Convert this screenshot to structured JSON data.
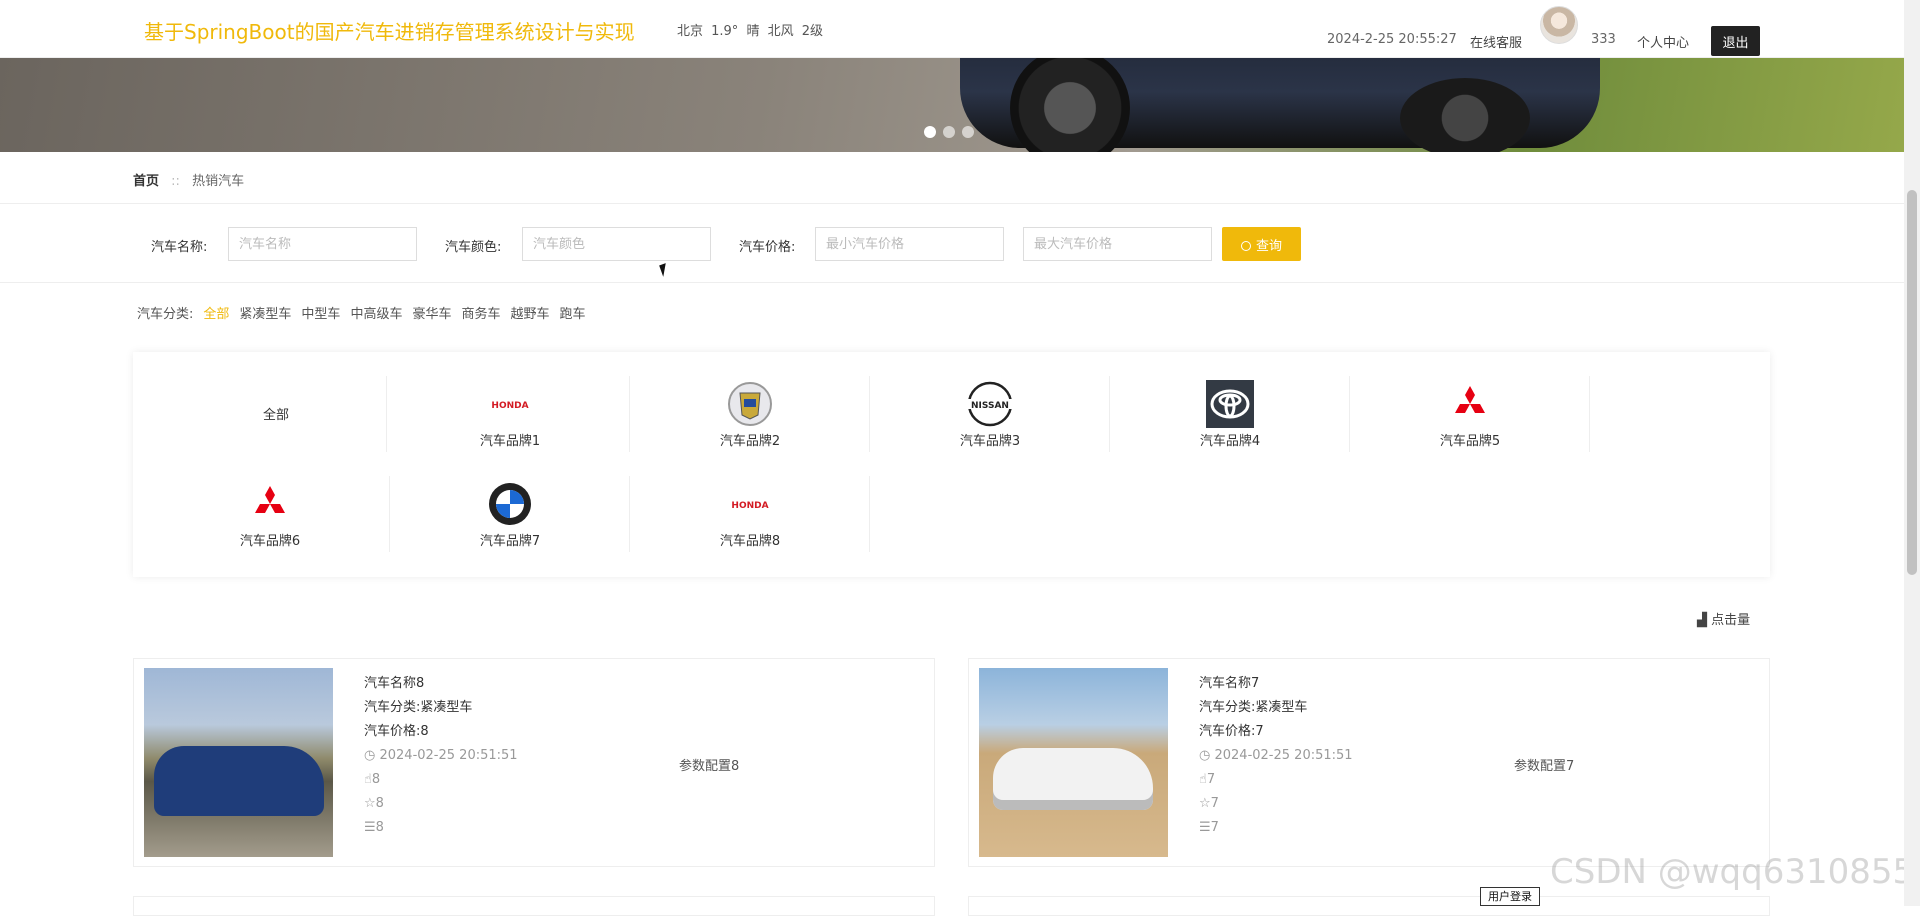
{
  "header": {
    "title": "基于SpringBoot的国产汽车进销存管理系统设计与实现",
    "weather": "北京  1.9°  晴  北风  2级",
    "datetime": "2024-2-25 20:55:27",
    "service": "在线客服",
    "username": "333",
    "personal": "个人中心",
    "logout": "退出"
  },
  "banner": {
    "slides": 3,
    "active": 1
  },
  "breadcrumb": {
    "home": "首页",
    "separator": "::",
    "current": "热销汽车"
  },
  "search": {
    "name_label": "汽车名称:",
    "name_placeholder": "汽车名称",
    "color_label": "汽车颜色:",
    "color_placeholder": "汽车颜色",
    "price_label": "汽车价格:",
    "min_placeholder": "最小汽车价格",
    "max_placeholder": "最大汽车价格",
    "button": "查询"
  },
  "category": {
    "label": "汽车分类:",
    "items": [
      "全部",
      "紧凑型车",
      "中型车",
      "中高级车",
      "豪华车",
      "商务车",
      "越野车",
      "跑车"
    ],
    "active": "全部"
  },
  "brands": {
    "all": "全部",
    "items": [
      {
        "name": "汽车品牌1",
        "logo": "honda-logo"
      },
      {
        "name": "汽车品牌2",
        "logo": "cadillac-logo"
      },
      {
        "name": "汽车品牌3",
        "logo": "nissan-logo"
      },
      {
        "name": "汽车品牌4",
        "logo": "toyota-logo"
      },
      {
        "name": "汽车品牌5",
        "logo": "mitsubishi-logo"
      },
      {
        "name": "汽车品牌6",
        "logo": "mitsubishi-logo"
      },
      {
        "name": "汽车品牌7",
        "logo": "bmw-logo"
      },
      {
        "name": "汽车品牌8",
        "logo": "honda-logo"
      }
    ],
    "logo_texts": {
      "honda": "HONDA",
      "nissan": "NISSAN"
    }
  },
  "sort": {
    "label": "点击量"
  },
  "products": [
    {
      "name": "汽车名称8",
      "category": "汽车分类:紧凑型车",
      "price": "汽车价格:8",
      "date": "2024-02-25 20:51:51",
      "likes": "8",
      "favorites": "8",
      "comments": "8",
      "param": "参数配置8"
    },
    {
      "name": "汽车名称7",
      "category": "汽车分类:紧凑型车",
      "price": "汽车价格:7",
      "date": "2024-02-25 20:51:51",
      "likes": "7",
      "favorites": "7",
      "comments": "7",
      "param": "参数配置7"
    }
  ],
  "floating": {
    "user_login": "用户登录"
  },
  "watermark": "CSDN @wqq6310855"
}
